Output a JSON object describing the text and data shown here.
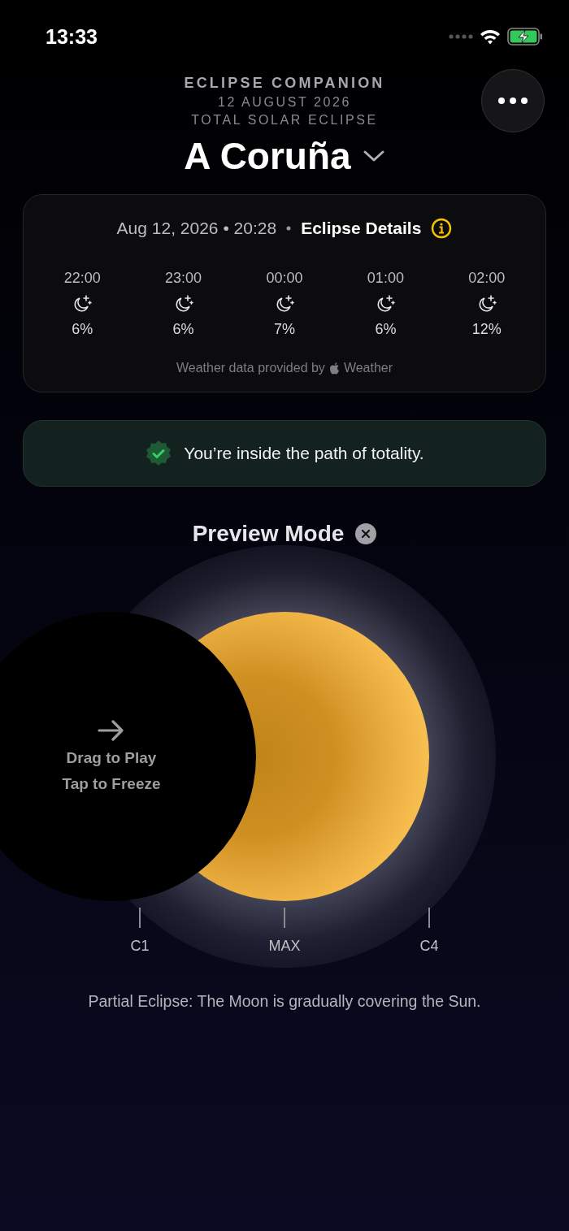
{
  "status_bar": {
    "time": "13:33"
  },
  "header": {
    "app_name": "ECLIPSE COMPANION",
    "date": "12 AUGUST 2026",
    "event": "TOTAL SOLAR ECLIPSE",
    "location": "A Coruña"
  },
  "forecast": {
    "datetime": "Aug 12, 2026 • 20:28",
    "details_link": "Eclipse Details",
    "hours": [
      {
        "time": "22:00",
        "value": "6%"
      },
      {
        "time": "23:00",
        "value": "6%"
      },
      {
        "time": "00:00",
        "value": "7%"
      },
      {
        "time": "01:00",
        "value": "6%"
      },
      {
        "time": "02:00",
        "value": "12%"
      }
    ],
    "attribution": "Weather data provided by",
    "attribution_source": "Weather"
  },
  "totality_banner": {
    "text": "You’re inside the path of totality."
  },
  "preview": {
    "title": "Preview Mode",
    "hint_lines": [
      "Drag to Play",
      "Tap to Freeze"
    ],
    "markers": [
      {
        "label": "C1"
      },
      {
        "label": "MAX"
      },
      {
        "label": "C4"
      }
    ],
    "caption": "Partial Eclipse: The Moon is gradually covering the Sun."
  }
}
